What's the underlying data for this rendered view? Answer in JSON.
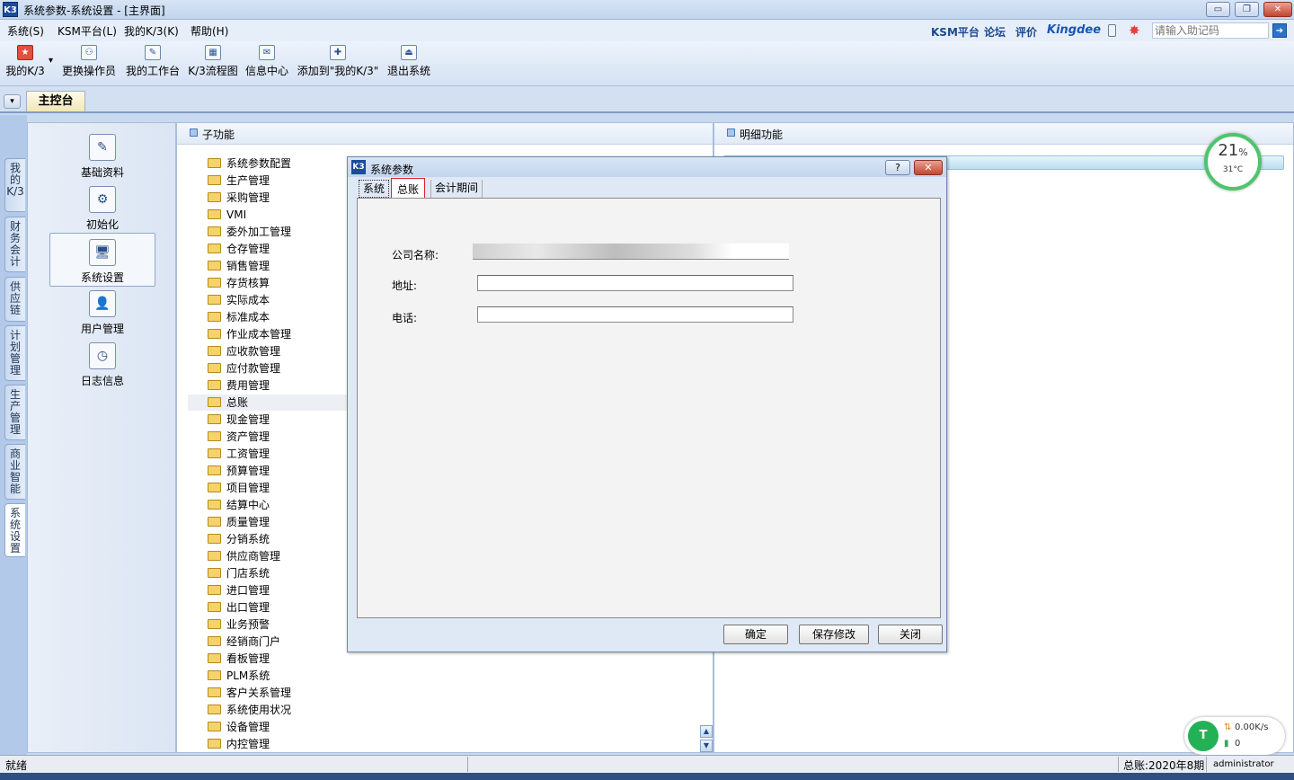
{
  "window": {
    "title": "系统参数-系统设置 - [主界面]",
    "app_icon": "K3",
    "controls": {
      "minimize": "▭",
      "restore": "❐",
      "close": "✕"
    }
  },
  "menu": {
    "items": [
      "系统(S)",
      "KSM平台(L)",
      "我的K/3(K)",
      "帮助(H)"
    ],
    "right_links": [
      "KSM平台",
      "论坛",
      "评价"
    ],
    "brand": "Kingdee",
    "search_placeholder": "请输入助记码",
    "go_icon": "➔"
  },
  "toolbar": {
    "items": [
      {
        "label": "我的K/3",
        "icon": "star-icon",
        "glyph": "★"
      },
      {
        "label": "更换操作员",
        "icon": "users-icon",
        "glyph": "⚇"
      },
      {
        "label": "我的工作台",
        "icon": "edit-icon",
        "glyph": "✎"
      },
      {
        "label": "K/3流程图",
        "icon": "flowchart-icon",
        "glyph": "▦"
      },
      {
        "label": "信息中心",
        "icon": "message-icon",
        "glyph": "✉"
      },
      {
        "label": "添加到\"我的K/3\"",
        "icon": "add-favorite-icon",
        "glyph": "✚"
      },
      {
        "label": "退出系统",
        "icon": "exit-icon",
        "glyph": "⏏"
      }
    ],
    "dropdown_glyph": "▾"
  },
  "tabs": {
    "main_tab": "主控台",
    "dropdown_glyph": "▾"
  },
  "vertical_tabs": [
    "我的K/3",
    "财务会计",
    "供应链",
    "计划管理",
    "生产管理",
    "商业智能",
    "系统设置"
  ],
  "functions": [
    {
      "label": "基础资料",
      "icon": "basic-data-icon",
      "glyph": "✎"
    },
    {
      "label": "初始化",
      "icon": "initialize-gear-icon",
      "glyph": "⚙"
    },
    {
      "label": "系统设置",
      "icon": "system-settings-icon",
      "glyph": "🖥"
    },
    {
      "label": "用户管理",
      "icon": "user-management-icon",
      "glyph": "👤"
    },
    {
      "label": "日志信息",
      "icon": "log-info-icon",
      "glyph": "◷"
    }
  ],
  "subpanel": {
    "header": "子功能",
    "items": [
      "系统参数配置",
      "生产管理",
      "采购管理",
      "VMI",
      "委外加工管理",
      "仓存管理",
      "销售管理",
      "存货核算",
      "实际成本",
      "标准成本",
      "作业成本管理",
      "应收款管理",
      "应付款管理",
      "费用管理",
      "总账",
      "现金管理",
      "资产管理",
      "工资管理",
      "预算管理",
      "项目管理",
      "结算中心",
      "质量管理",
      "分销系统",
      "供应商管理",
      "门店系统",
      "进口管理",
      "出口管理",
      "业务预警",
      "经销商门户",
      "看板管理",
      "PLM系统",
      "客户关系管理",
      "系统使用状况",
      "设备管理",
      "内控管理"
    ],
    "selected_index": 14,
    "scroll_up": "▲",
    "scroll_down": "▼"
  },
  "detailpanel": {
    "header": "明细功能"
  },
  "gauge": {
    "percent": "21",
    "unit": "%",
    "temperature": "31°C"
  },
  "dialog": {
    "title": "系统参数",
    "help": "?",
    "close": "✕",
    "tabs": [
      "系统",
      "总账",
      "会计期间"
    ],
    "active_tab": "总账",
    "fields": [
      {
        "label": "公司名称:",
        "value": ""
      },
      {
        "label": "地址:",
        "value": ""
      },
      {
        "label": "电话:",
        "value": ""
      }
    ],
    "buttons": {
      "ok": "确定",
      "save": "保存修改",
      "close": "关闭"
    }
  },
  "statusbar": {
    "status": "就绪",
    "period": "总账:2020年8期",
    "user": "administrator"
  },
  "netwidget": {
    "speed": "0.00K/s",
    "count": "0",
    "logo": "T"
  }
}
